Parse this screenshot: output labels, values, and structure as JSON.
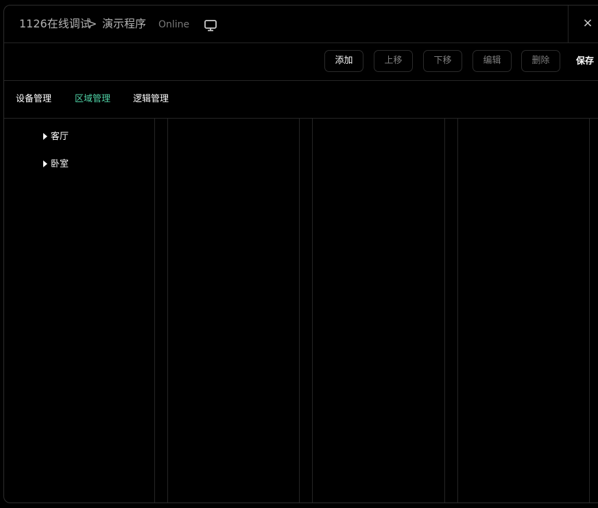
{
  "titlebar": {
    "project": "1126在线调试",
    "separator": ">",
    "program": "演示程序",
    "status": "Online",
    "monitor_icon": "monitor-icon",
    "close_icon": "×"
  },
  "toolbar": {
    "add_label": "添加",
    "move_up_label": "上移",
    "move_down_label": "下移",
    "edit_label": "编辑",
    "delete_label": "删除",
    "save_label": "保存"
  },
  "tabs": {
    "device": "设备管理",
    "area": "区域管理",
    "logic": "逻辑管理",
    "active": "区域管理",
    "active_color": "#4fd1a5"
  },
  "tree": {
    "items": [
      {
        "label": "客厅",
        "expanded": false
      },
      {
        "label": "卧室",
        "expanded": false
      }
    ]
  }
}
